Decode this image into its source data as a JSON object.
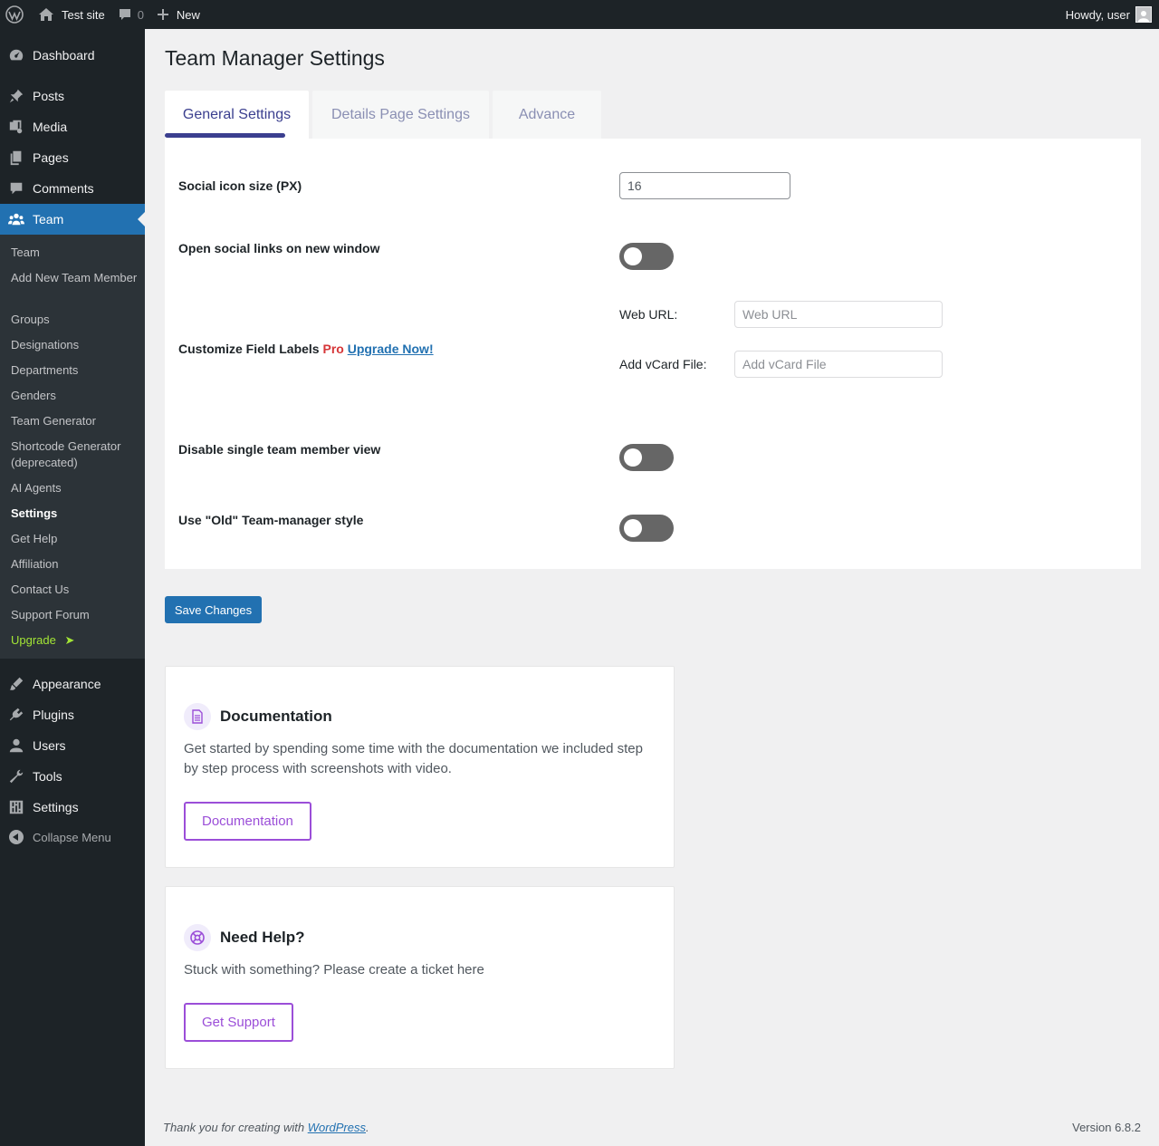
{
  "adminbar": {
    "site_name": "Test site",
    "comments_count": "0",
    "new_label": "New",
    "howdy": "Howdy, user"
  },
  "sidebar": {
    "menu": [
      {
        "label": "Dashboard",
        "icon": "dashboard-icon"
      },
      {
        "label": "Posts",
        "icon": "pin-icon"
      },
      {
        "label": "Media",
        "icon": "media-icon"
      },
      {
        "label": "Pages",
        "icon": "pages-icon"
      },
      {
        "label": "Comments",
        "icon": "comment-icon"
      },
      {
        "label": "Team",
        "icon": "team-icon"
      },
      {
        "label": "Appearance",
        "icon": "brush-icon"
      },
      {
        "label": "Plugins",
        "icon": "plug-icon"
      },
      {
        "label": "Users",
        "icon": "user-icon"
      },
      {
        "label": "Tools",
        "icon": "wrench-icon"
      },
      {
        "label": "Settings",
        "icon": "sliders-icon"
      }
    ],
    "submenu": [
      "Team",
      "Add New Team Member",
      "Groups",
      "Designations",
      "Departments",
      "Genders",
      "Team Generator",
      "Shortcode Generator (deprecated)",
      "AI Agents",
      "Settings",
      "Get Help",
      "Affiliation",
      "Contact Us",
      "Support Forum",
      "Upgrade"
    ],
    "upgrade_arrow": "➤",
    "collapse": "Collapse Menu"
  },
  "page": {
    "title": "Team Manager Settings",
    "tabs": [
      "General Settings",
      "Details Page Settings",
      "Advance"
    ]
  },
  "settings": {
    "icon_size_label": "Social icon size (PX)",
    "icon_size_value": "16",
    "new_window_label": "Open social links on new window",
    "new_window_on": false,
    "customize_label": "Customize Field Labels",
    "pro_badge": "Pro",
    "upgrade_link": "Upgrade Now!",
    "web_url_label": "Web URL:",
    "web_url_placeholder": "Web URL",
    "vcard_label": "Add vCard File:",
    "vcard_placeholder": "Add vCard File",
    "disable_single_label": "Disable single team member view",
    "disable_single_on": false,
    "old_style_label": "Use \"Old\" Team-manager style",
    "old_style_on": false,
    "save": "Save Changes"
  },
  "cards": {
    "doc": {
      "title": "Documentation",
      "text": "Get started by spending some time with the documentation we included step by step process with screenshots with video.",
      "button": "Documentation"
    },
    "help": {
      "title": "Need Help?",
      "text": "Stuck with something? Please create a ticket here",
      "button": "Get Support"
    }
  },
  "footer": {
    "thanks_pre": "Thank you for creating with ",
    "wp_link": "WordPress",
    "thanks_post": ".",
    "version": "Version 6.8.2"
  },
  "colors": {
    "accent": "#2271b1",
    "sidebar_bg": "#1d2327",
    "tab_active": "#3b3f8f",
    "card_button": "#9b4ed8",
    "pro": "#d63638",
    "upgrade_menu": "#a3e635"
  }
}
